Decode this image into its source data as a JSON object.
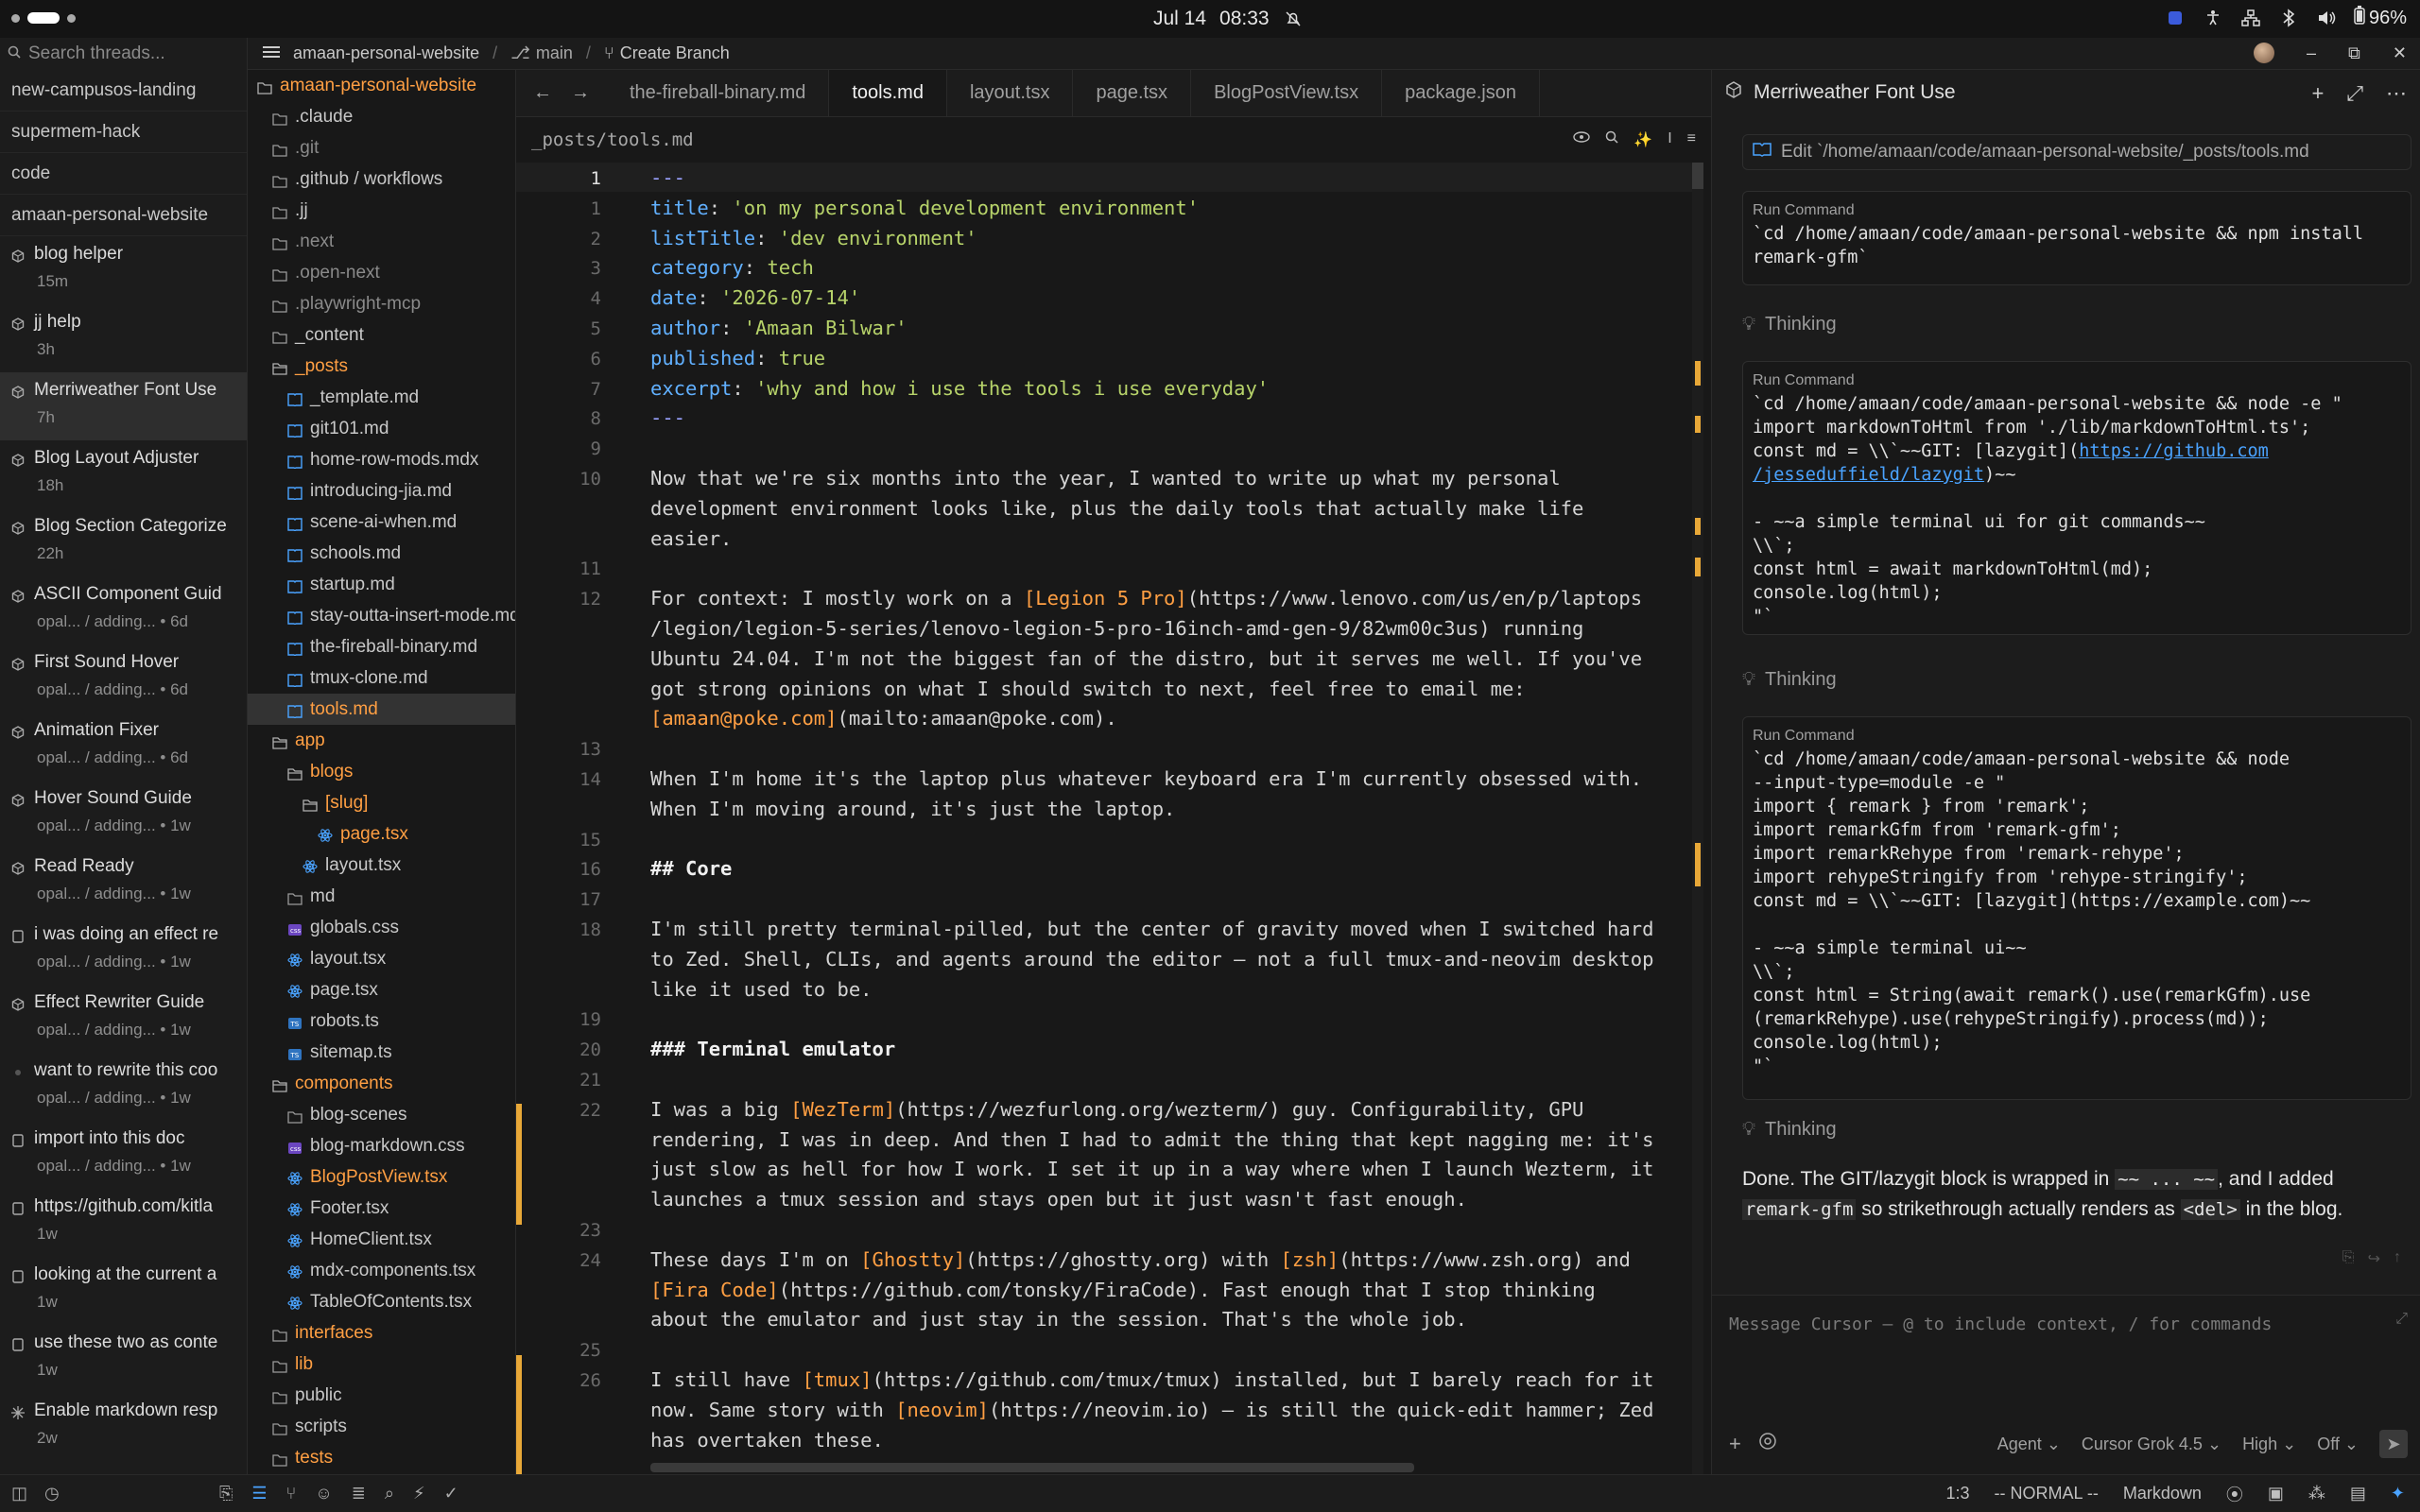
{
  "system": {
    "date": "Jul 14",
    "time": "08:33",
    "battery": "96%"
  },
  "threads": {
    "search_placeholder": "Search threads...",
    "pinned": [
      "new-campusos-landing",
      "supermem-hack",
      "code",
      "amaan-personal-website"
    ],
    "items": [
      {
        "title": "blog helper",
        "sub": "15m",
        "icon": "cube-icon"
      },
      {
        "title": "jj help",
        "sub": "3h",
        "icon": "cube-icon"
      },
      {
        "title": "Merriweather Font Use",
        "sub": "7h",
        "icon": "cube-icon",
        "selected": true
      },
      {
        "title": "Blog Layout Adjuster",
        "sub": "18h",
        "icon": "cube-icon"
      },
      {
        "title": "Blog Section Categorize",
        "sub": "22h",
        "icon": "cube-icon"
      },
      {
        "title": "ASCII Component Guid",
        "sub": "opal... / adding... • 6d",
        "icon": "cube-icon"
      },
      {
        "title": "First Sound Hover",
        "sub": "opal... / adding... • 6d",
        "icon": "cube-icon"
      },
      {
        "title": "Animation Fixer",
        "sub": "opal... / adding... • 6d",
        "icon": "cube-icon"
      },
      {
        "title": "Hover Sound Guide",
        "sub": "opal... / adding... • 1w",
        "icon": "cube-icon"
      },
      {
        "title": "Read Ready",
        "sub": "opal... / adding... • 1w",
        "icon": "cube-icon"
      },
      {
        "title": "i was doing an effect re",
        "sub": "opal... / adding... • 1w",
        "icon": "square-icon"
      },
      {
        "title": "Effect Rewriter Guide",
        "sub": "opal... / adding... • 1w",
        "icon": "cube-icon"
      },
      {
        "title": "want to rewrite this coo",
        "sub": "opal... / adding... • 1w",
        "icon": "dot-icon"
      },
      {
        "title": "import  into this doc",
        "sub": "opal... / adding... • 1w",
        "icon": "square-icon"
      },
      {
        "title": "https://github.com/kitla",
        "sub": "1w",
        "icon": "square-icon"
      },
      {
        "title": "looking at the current a",
        "sub": "1w",
        "icon": "square-icon"
      },
      {
        "title": "use these two as conte",
        "sub": "1w",
        "icon": "square-icon"
      },
      {
        "title": "Enable markdown resp",
        "sub": "2w",
        "icon": "spark-icon"
      }
    ]
  },
  "header": {
    "repo": "amaan-personal-website",
    "branch": "main",
    "create_branch": "Create Branch"
  },
  "tree": {
    "root": "amaan-personal-website",
    "items": [
      {
        "name": ".claude",
        "depth": 1,
        "kind": "folder",
        "color": "#c8c8c8"
      },
      {
        "name": ".git",
        "depth": 1,
        "kind": "folder",
        "color": "#8a8a8a"
      },
      {
        "name": ".github / workflows",
        "depth": 1,
        "kind": "folder",
        "color": "#c8c8c8"
      },
      {
        "name": ".jj",
        "depth": 1,
        "kind": "folder",
        "color": "#c8c8c8"
      },
      {
        "name": ".next",
        "depth": 1,
        "kind": "folder",
        "color": "#8a8a8a"
      },
      {
        "name": ".open-next",
        "depth": 1,
        "kind": "folder",
        "color": "#8a8a8a"
      },
      {
        "name": ".playwright-mcp",
        "depth": 1,
        "kind": "folder",
        "color": "#8a8a8a"
      },
      {
        "name": "_content",
        "depth": 1,
        "kind": "folder",
        "color": "#c8c8c8"
      },
      {
        "name": "_posts",
        "depth": 1,
        "kind": "folder-open",
        "color": "#ff9f43"
      },
      {
        "name": "_template.md",
        "depth": 2,
        "kind": "md",
        "color": "#c8c8c8"
      },
      {
        "name": "git101.md",
        "depth": 2,
        "kind": "md",
        "color": "#c8c8c8"
      },
      {
        "name": "home-row-mods.mdx",
        "depth": 2,
        "kind": "md",
        "color": "#c8c8c8"
      },
      {
        "name": "introducing-jia.md",
        "depth": 2,
        "kind": "md",
        "color": "#c8c8c8"
      },
      {
        "name": "scene-ai-when.md",
        "depth": 2,
        "kind": "md",
        "color": "#c8c8c8"
      },
      {
        "name": "schools.md",
        "depth": 2,
        "kind": "md",
        "color": "#c8c8c8"
      },
      {
        "name": "startup.md",
        "depth": 2,
        "kind": "md",
        "color": "#c8c8c8"
      },
      {
        "name": "stay-outta-insert-mode.md",
        "depth": 2,
        "kind": "md",
        "color": "#c8c8c8"
      },
      {
        "name": "the-fireball-binary.md",
        "depth": 2,
        "kind": "md",
        "color": "#c8c8c8"
      },
      {
        "name": "tmux-clone.md",
        "depth": 2,
        "kind": "md",
        "color": "#c8c8c8"
      },
      {
        "name": "tools.md",
        "depth": 2,
        "kind": "md",
        "color": "#ff9f43",
        "selected": true
      },
      {
        "name": "app",
        "depth": 1,
        "kind": "folder-open",
        "color": "#ff9f43"
      },
      {
        "name": "blogs",
        "depth": 2,
        "kind": "folder-open",
        "color": "#ff9f43"
      },
      {
        "name": "[slug]",
        "depth": 3,
        "kind": "folder-open",
        "color": "#ff9f43"
      },
      {
        "name": "page.tsx",
        "depth": 4,
        "kind": "react",
        "color": "#ff9f43"
      },
      {
        "name": "layout.tsx",
        "depth": 3,
        "kind": "react",
        "color": "#c8c8c8"
      },
      {
        "name": "md",
        "depth": 2,
        "kind": "folder",
        "color": "#c8c8c8"
      },
      {
        "name": "globals.css",
        "depth": 2,
        "kind": "css",
        "color": "#c8c8c8"
      },
      {
        "name": "layout.tsx",
        "depth": 2,
        "kind": "react",
        "color": "#c8c8c8"
      },
      {
        "name": "page.tsx",
        "depth": 2,
        "kind": "react",
        "color": "#c8c8c8"
      },
      {
        "name": "robots.ts",
        "depth": 2,
        "kind": "ts",
        "color": "#c8c8c8"
      },
      {
        "name": "sitemap.ts",
        "depth": 2,
        "kind": "ts",
        "color": "#c8c8c8"
      },
      {
        "name": "components",
        "depth": 1,
        "kind": "folder-open",
        "color": "#ff9f43"
      },
      {
        "name": "blog-scenes",
        "depth": 2,
        "kind": "folder",
        "color": "#c8c8c8"
      },
      {
        "name": "blog-markdown.css",
        "depth": 2,
        "kind": "css",
        "color": "#c8c8c8"
      },
      {
        "name": "BlogPostView.tsx",
        "depth": 2,
        "kind": "react",
        "color": "#ff9f43"
      },
      {
        "name": "Footer.tsx",
        "depth": 2,
        "kind": "react",
        "color": "#c8c8c8"
      },
      {
        "name": "HomeClient.tsx",
        "depth": 2,
        "kind": "react",
        "color": "#c8c8c8"
      },
      {
        "name": "mdx-components.tsx",
        "depth": 2,
        "kind": "react",
        "color": "#c8c8c8"
      },
      {
        "name": "TableOfContents.tsx",
        "depth": 2,
        "kind": "react",
        "color": "#c8c8c8"
      },
      {
        "name": "interfaces",
        "depth": 1,
        "kind": "folder",
        "color": "#ff9f43"
      },
      {
        "name": "lib",
        "depth": 1,
        "kind": "folder",
        "color": "#ff9f43"
      },
      {
        "name": "public",
        "depth": 1,
        "kind": "folder",
        "color": "#c8c8c8"
      },
      {
        "name": "scripts",
        "depth": 1,
        "kind": "folder",
        "color": "#c8c8c8"
      },
      {
        "name": "tests",
        "depth": 1,
        "kind": "folder",
        "color": "#ff9f43"
      }
    ]
  },
  "editor": {
    "tabs": [
      "the-fireball-binary.md",
      "tools.md",
      "layout.tsx",
      "page.tsx",
      "BlogPostView.tsx",
      "package.json"
    ],
    "active_tab": 1,
    "path": "_posts/tools.md",
    "lines": [
      {
        "n": "1",
        "cur": true,
        "segs": [
          [
            "p",
            "---"
          ]
        ]
      },
      {
        "n": "1",
        "segs": [
          [
            "k",
            "title"
          ],
          [
            "",
            ": "
          ],
          [
            "s",
            "'on my personal development environment'"
          ]
        ]
      },
      {
        "n": "2",
        "segs": [
          [
            "k",
            "listTitle"
          ],
          [
            "",
            ": "
          ],
          [
            "s",
            "'dev environment'"
          ]
        ]
      },
      {
        "n": "3",
        "segs": [
          [
            "k",
            "category"
          ],
          [
            "",
            ": "
          ],
          [
            "s",
            "tech"
          ]
        ]
      },
      {
        "n": "4",
        "segs": [
          [
            "k",
            "date"
          ],
          [
            "",
            ": "
          ],
          [
            "s",
            "'2026-07-14'"
          ]
        ]
      },
      {
        "n": "5",
        "segs": [
          [
            "k",
            "author"
          ],
          [
            "",
            ": "
          ],
          [
            "s",
            "'Amaan Bilwar'"
          ]
        ]
      },
      {
        "n": "6",
        "segs": [
          [
            "k",
            "published"
          ],
          [
            "",
            ": "
          ],
          [
            "s",
            "true"
          ]
        ]
      },
      {
        "n": "7",
        "segs": [
          [
            "k",
            "excerpt"
          ],
          [
            "",
            ": "
          ],
          [
            "s",
            "'why and how i use the tools i use everyday'"
          ]
        ]
      },
      {
        "n": "8",
        "segs": [
          [
            "p",
            "---"
          ]
        ]
      },
      {
        "n": "9",
        "segs": []
      },
      {
        "n": "10",
        "segs": [
          [
            "",
            "Now that we're six months into the year, I wanted to write up what my personal"
          ]
        ]
      },
      {
        "n": "",
        "segs": [
          [
            "",
            "development environment looks like, plus the daily tools that actually make life"
          ]
        ]
      },
      {
        "n": "",
        "segs": [
          [
            "",
            "easier."
          ]
        ]
      },
      {
        "n": "11",
        "segs": []
      },
      {
        "n": "12",
        "segs": [
          [
            "",
            "For context: I mostly work on a "
          ],
          [
            "o",
            "[Legion 5 Pro]"
          ],
          [
            "",
            "(https://www.lenovo.com/us/en/p/laptops"
          ]
        ]
      },
      {
        "n": "",
        "segs": [
          [
            "",
            "/legion/legion-5-series/lenovo-legion-5-pro-16inch-amd-gen-9/82wm00c3us)"
          ],
          [
            "",
            " running"
          ]
        ]
      },
      {
        "n": "",
        "segs": [
          [
            "",
            "Ubuntu 24.04. I'm not the biggest fan of the distro, but it serves me well. If you've"
          ]
        ]
      },
      {
        "n": "",
        "segs": [
          [
            "",
            "got strong opinions on what I should switch to next, feel free to email me:"
          ]
        ]
      },
      {
        "n": "",
        "segs": [
          [
            "o",
            "[amaan@poke.com]"
          ],
          [
            "",
            "(mailto:amaan@poke.com)."
          ]
        ]
      },
      {
        "n": "13",
        "segs": []
      },
      {
        "n": "14",
        "segs": [
          [
            "",
            "When I'm home it's the laptop plus whatever keyboard era I'm currently obsessed with."
          ]
        ]
      },
      {
        "n": "",
        "segs": [
          [
            "",
            "When I'm moving around, it's just the laptop."
          ]
        ]
      },
      {
        "n": "15",
        "segs": []
      },
      {
        "n": "16",
        "segs": [
          [
            "b",
            "## Core"
          ]
        ]
      },
      {
        "n": "17",
        "segs": []
      },
      {
        "n": "18",
        "segs": [
          [
            "",
            "I'm still pretty terminal-pilled, but the center of gravity moved when I switched hard"
          ]
        ]
      },
      {
        "n": "",
        "segs": [
          [
            "",
            "to Zed. Shell, CLIs, and agents around the editor — not a full tmux-and-neovim desktop"
          ]
        ]
      },
      {
        "n": "",
        "segs": [
          [
            "",
            "like it used to be."
          ]
        ]
      },
      {
        "n": "19",
        "segs": []
      },
      {
        "n": "20",
        "segs": [
          [
            "b",
            "### Terminal emulator"
          ]
        ]
      },
      {
        "n": "21",
        "segs": []
      },
      {
        "n": "22",
        "segs": [
          [
            "",
            "I was a big "
          ],
          [
            "o",
            "[WezTerm]"
          ],
          [
            "",
            "(https://wezfurlong.org/wezterm/) guy. Configurability, GPU"
          ]
        ]
      },
      {
        "n": "",
        "segs": [
          [
            "",
            "rendering, I was in deep. And then I had to admit the thing that kept nagging me: it's"
          ]
        ]
      },
      {
        "n": "",
        "segs": [
          [
            "",
            "just slow as hell for how I work. I set it up in a way where when I launch Wezterm, it"
          ]
        ]
      },
      {
        "n": "",
        "segs": [
          [
            "",
            "launches a tmux session and stays open but it just wasn't fast enough."
          ]
        ]
      },
      {
        "n": "23",
        "segs": []
      },
      {
        "n": "24",
        "segs": [
          [
            "",
            "These days I'm on "
          ],
          [
            "o",
            "[Ghostty]"
          ],
          [
            "",
            "(https://ghostty.org) with "
          ],
          [
            "o",
            "[zsh]"
          ],
          [
            "",
            "(https://www.zsh.org) and"
          ]
        ]
      },
      {
        "n": "",
        "segs": [
          [
            "o",
            "[Fira Code]"
          ],
          [
            "",
            "(https://github.com/tonsky/FiraCode). Fast enough that I stop thinking"
          ]
        ]
      },
      {
        "n": "",
        "segs": [
          [
            "",
            "about the emulator and just stay in the session. That's the whole job."
          ]
        ]
      },
      {
        "n": "25",
        "segs": []
      },
      {
        "n": "26",
        "segs": [
          [
            "",
            "I still have "
          ],
          [
            "o",
            "[tmux]"
          ],
          [
            "",
            "(https://github.com/tmux/tmux) installed, but I barely reach for it"
          ]
        ]
      },
      {
        "n": "",
        "segs": [
          [
            "",
            "now. Same story with "
          ],
          [
            "o",
            "[neovim]"
          ],
          [
            "",
            "(https://neovim.io) — is still the quick-edit hammer; Zed"
          ]
        ]
      },
      {
        "n": "",
        "segs": [
          [
            "",
            "has overtaken these."
          ]
        ]
      }
    ]
  },
  "chat": {
    "title": "Merriweather Font Use",
    "edit_text": "Edit `/home/amaan/code/amaan-personal-website/_posts/tools.md",
    "run_label": "Run Command",
    "thinking": "Thinking",
    "cmd1": "`cd /home/amaan/code/amaan-personal-website && npm install\nremark-gfm`",
    "cmd2_a": "`cd /home/amaan/code/amaan-personal-website && node -e \"\nimport markdownToHtml from './lib/markdownToHtml.ts';\nconst md = \\\\`~~GIT: [lazygit](",
    "cmd2_link1": "https://github.com",
    "cmd2_link2": "/jesseduffield/lazygit",
    "cmd2_b": ")~~\n\n- ~~a simple terminal ui for git commands~~\n\\\\`;\nconst html = await markdownToHtml(md);\nconsole.log(html);\n\"`",
    "cmd3": "`cd /home/amaan/code/amaan-personal-website && node\n--input-type=module -e \"\nimport { remark } from 'remark';\nimport remarkGfm from 'remark-gfm';\nimport remarkRehype from 'remark-rehype';\nimport rehypeStringify from 'rehype-stringify';\nconst md = \\\\`~~GIT: [lazygit](https://example.com)~~\n\n- ~~a simple terminal ui~~\n\\\\`;\nconst html = String(await remark().use(remarkGfm).use\n(remarkRehype).use(rehypeStringify).process(md));\nconsole.log(html);\n\"`",
    "done_1": "Done. The GIT/lazygit block is wrapped in ",
    "done_code1": "~~ ... ~~",
    "done_2": ", and I added",
    "done_code2": "remark-gfm",
    "done_3": " so strikethrough actually renders as ",
    "done_code3": "<del>",
    "done_4": " in the blog.",
    "input_placeholder": "Message Cursor — @ to include context, / for commands",
    "agent": "Agent",
    "model": "Cursor Grok 4.5",
    "effort": "High",
    "toggle": "Off"
  },
  "status": {
    "pos": "1:3",
    "mode": "-- NORMAL --",
    "lang": "Markdown"
  },
  "colors": {
    "accent_orange": "#ff9f43",
    "key_blue": "#61b0ff",
    "string_green": "#b7d36a",
    "link_blue": "#4aa3ff"
  }
}
